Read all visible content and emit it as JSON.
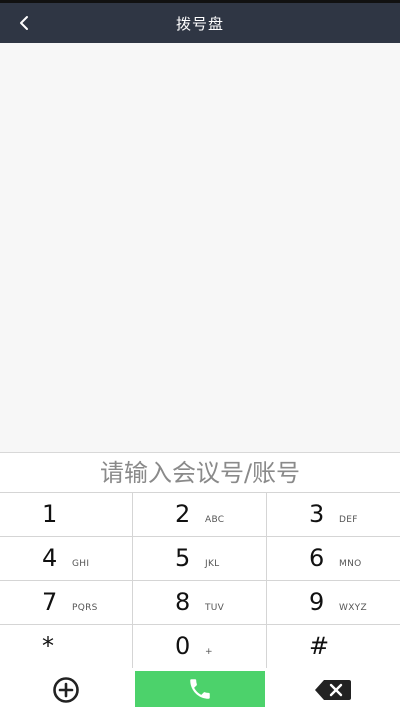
{
  "header": {
    "title": "拨号盘",
    "back_icon": "chevron-left-icon"
  },
  "dial_input": {
    "value": "",
    "placeholder": "请输入会议号/账号"
  },
  "keypad": {
    "keys": [
      {
        "digit": "1",
        "letters": ""
      },
      {
        "digit": "2",
        "letters": "ABC"
      },
      {
        "digit": "3",
        "letters": "DEF"
      },
      {
        "digit": "4",
        "letters": "GHI"
      },
      {
        "digit": "5",
        "letters": "JKL"
      },
      {
        "digit": "6",
        "letters": "MNO"
      },
      {
        "digit": "7",
        "letters": "PQRS"
      },
      {
        "digit": "8",
        "letters": "TUV"
      },
      {
        "digit": "9",
        "letters": "WXYZ"
      },
      {
        "digit": "*",
        "letters": ""
      },
      {
        "digit": "0",
        "letters": "+"
      },
      {
        "digit": "#",
        "letters": ""
      }
    ]
  },
  "actions": {
    "add_icon": "plus-circle-icon",
    "call_icon": "phone-icon",
    "delete_icon": "backspace-icon"
  },
  "colors": {
    "header_bg": "#2f3644",
    "call_green": "#4cd26b",
    "divider": "#d5d5d5"
  }
}
